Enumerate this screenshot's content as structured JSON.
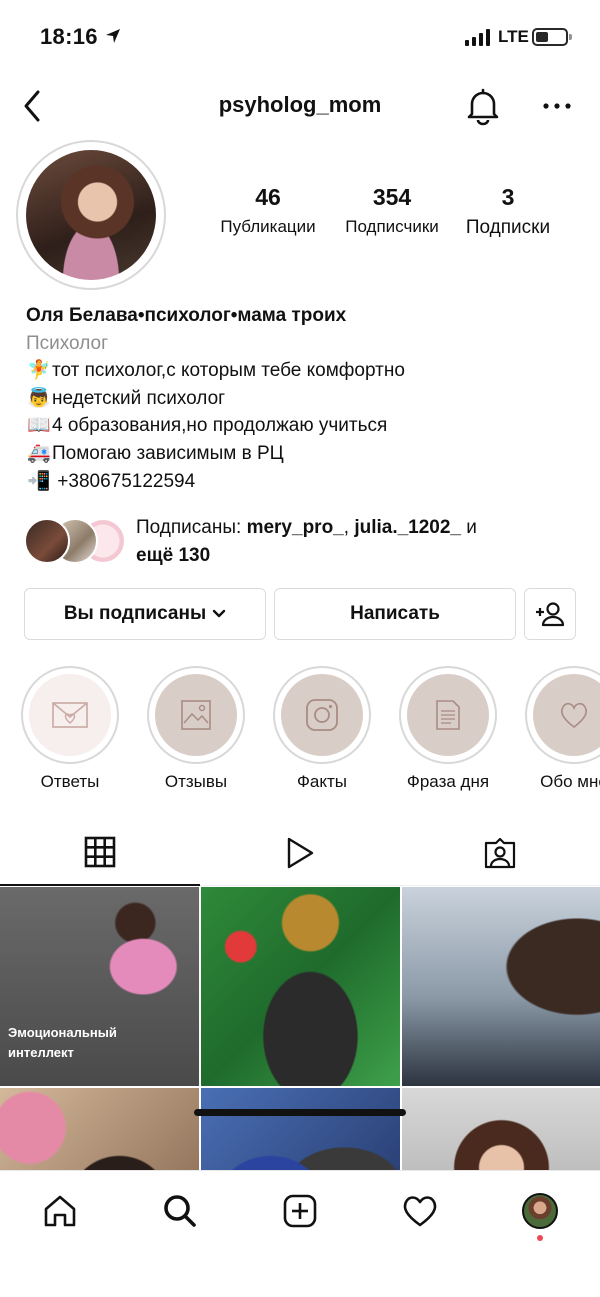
{
  "status_bar": {
    "time": "18:16",
    "network": "LTE"
  },
  "header": {
    "username": "psyholog_mom"
  },
  "stats": [
    {
      "value": "46",
      "label": "Публикации"
    },
    {
      "value": "354",
      "label": "Подписчики"
    },
    {
      "value": "3",
      "label": "Подписки"
    }
  ],
  "bio": {
    "name": "Оля Белава•психолог•мама троих",
    "category": "Психолог",
    "lines": [
      {
        "emoji": "🧚",
        "text": "тот психолог,с которым тебе комфортно"
      },
      {
        "emoji": "👼",
        "text": "недетский психолог"
      },
      {
        "emoji": "📖",
        "text": "4 образования,но продолжаю учиться"
      },
      {
        "emoji": "🚑",
        "text": "Помогаю зависимым в РЦ"
      },
      {
        "emoji": "📲",
        "text": " +380675122594"
      }
    ]
  },
  "followed_by": {
    "prefix": "Подписаны: ",
    "user1": "mery_pro_",
    "sep": ", ",
    "user2": "julia._1202_",
    "and": " и ",
    "more": "ещё 130"
  },
  "actions": {
    "following_label": "Вы подписаны",
    "message_label": "Написать"
  },
  "highlights": [
    {
      "label": "Ответы",
      "icon": "envelope-heart-icon",
      "color": "#f7eeee"
    },
    {
      "label": "Отзывы",
      "icon": "photo-icon",
      "color": "#d9cdc8"
    },
    {
      "label": "Факты",
      "icon": "instagram-icon",
      "color": "#d9cdc8"
    },
    {
      "label": "Фраза дня",
      "icon": "document-icon",
      "color": "#d9cdc8"
    },
    {
      "label": "Обо мне",
      "icon": "heart-icon",
      "color": "#d9cdc8"
    }
  ],
  "posts": [
    {
      "caption_line1": "Эмоциональный",
      "caption_line2": "интеллект"
    }
  ],
  "colors": {
    "accent_dot": "#ed4956",
    "border": "#dbdbdb",
    "secondary_text": "#8e8e8e"
  }
}
